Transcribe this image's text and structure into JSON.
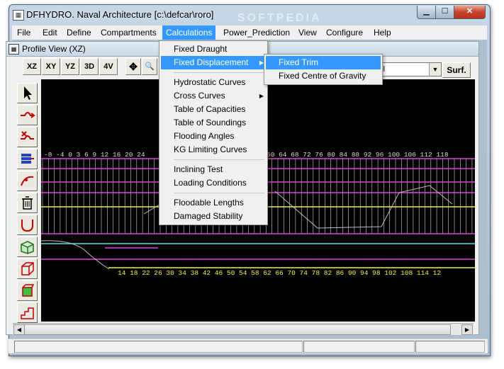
{
  "window": {
    "title": "DFHYDRO. Naval Architecture [c:\\defcar\\roro]",
    "watermark": "SOFTPEDIA",
    "app_icon_glyph": "▦",
    "min_glyph": "▁",
    "max_glyph": "☐",
    "close_glyph": "✕"
  },
  "menubar": [
    "File",
    "Edit",
    "Define",
    "Compartments",
    "Calculations",
    "Power_Prediction",
    "View",
    "Configure",
    "Help"
  ],
  "child": {
    "title": "Profile View (XZ)",
    "icon_glyph": "▦"
  },
  "toolbar": {
    "views": [
      "XZ",
      "XY",
      "YZ",
      "3D",
      "4V"
    ],
    "pan_glyph": "✥",
    "zoom_glyph": "🔍",
    "combo_value": "ll",
    "combo_arrow": "▼",
    "surf_label": "Surf."
  },
  "calc_menu": {
    "groups": [
      [
        "Fixed Draught",
        "Fixed Displacement"
      ],
      [
        "Hydrostatic Curves",
        "Cross Curves",
        "Table of Capacities",
        "Table of Soundings",
        "Flooding Angles",
        "KG Limiting Curves"
      ],
      [
        "Inclining Test",
        "Loading Conditions"
      ],
      [
        "Floodable Lengths",
        "Damaged Stability"
      ]
    ],
    "submenu_arrow": "▶"
  },
  "submenu": [
    "Fixed Trim",
    "Fixed Centre of Gravity"
  ],
  "drawing": {
    "top_axis": "-8  -4   0   3   6   9  12  16  20  24",
    "top_axis_right": "60   64   68   72   76   80   84   88   92   96   100   106   112   118",
    "bottom_axis": "14  18  22  26  30  34  38  42  46  50  54  58  62  66  70  74  78  82  86  90  94  98  102  108  114  12",
    "colors": {
      "magenta": "#e040e0",
      "yellow": "#f0f040",
      "cyan": "#50e0e0",
      "grid": "#d8d8d8",
      "hull": "#c0c0c0"
    }
  },
  "scroll": {
    "left_arrow": "◀",
    "right_arrow": "▶"
  }
}
